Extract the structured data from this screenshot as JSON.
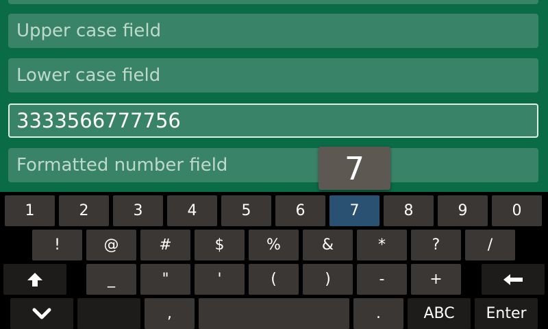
{
  "fields": {
    "upper_case_placeholder": "Upper case field",
    "lower_case_placeholder": "Lower case field",
    "active_value": "3333566777756",
    "formatted_number_placeholder": "Formatted number field"
  },
  "key_preview": "7",
  "keyboard": {
    "row1": [
      "1",
      "2",
      "3",
      "4",
      "5",
      "6",
      "7",
      "8",
      "9",
      "0"
    ],
    "row2": [
      "!",
      "@",
      "#",
      "$",
      "%",
      "&",
      "*",
      "?",
      "/"
    ],
    "row3": [
      "_",
      "\"",
      "'",
      "(",
      ")",
      "-",
      "+"
    ],
    "row4": {
      "comma": ",",
      "period": ".",
      "abc": "ABC",
      "enter": "Enter"
    },
    "pressed_key": "7",
    "icons": {
      "shift": "arrow-up-icon",
      "backspace": "arrow-left-icon",
      "hide": "chevron-down-icon"
    }
  },
  "colors": {
    "app_background": "#0a6b47",
    "field_background": "#398468",
    "key_background": "#3b3734",
    "key_pressed": "#2a5172"
  }
}
